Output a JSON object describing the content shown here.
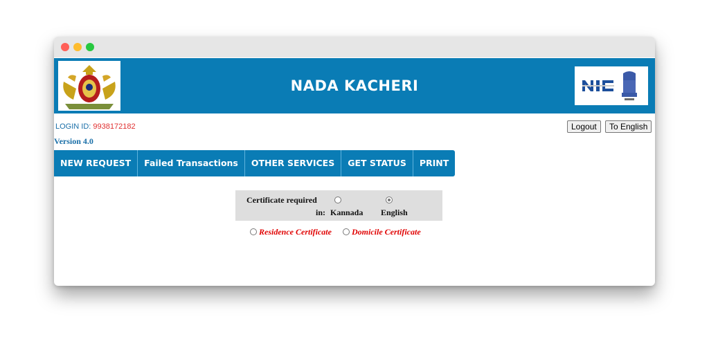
{
  "header": {
    "title": "NADA KACHERI"
  },
  "account": {
    "login_label": "LOGIN ID:",
    "login_id": "9938172182",
    "version": "Version 4.0"
  },
  "top_buttons": {
    "logout": "Logout",
    "language": "To English"
  },
  "nav": {
    "items": [
      "NEW REQUEST",
      "Failed Transactions",
      "OTHER SERVICES",
      "GET STATUS",
      "PRINT"
    ]
  },
  "certificate_language": {
    "label_line1": "Certificate required",
    "label_line2": "in:",
    "options": [
      "Kannada",
      "English"
    ],
    "selected": "English"
  },
  "certificate_type": {
    "options": [
      "Residence Certificate",
      "Domicile Certificate"
    ]
  },
  "colors": {
    "header_blue": "#0a7cb5",
    "login_text": "#1a6fa8",
    "accent_red": "#e00000"
  },
  "icons": {
    "left_emblem": "karnataka-emblem-icon",
    "right_emblem": "nic-logo-icon"
  }
}
